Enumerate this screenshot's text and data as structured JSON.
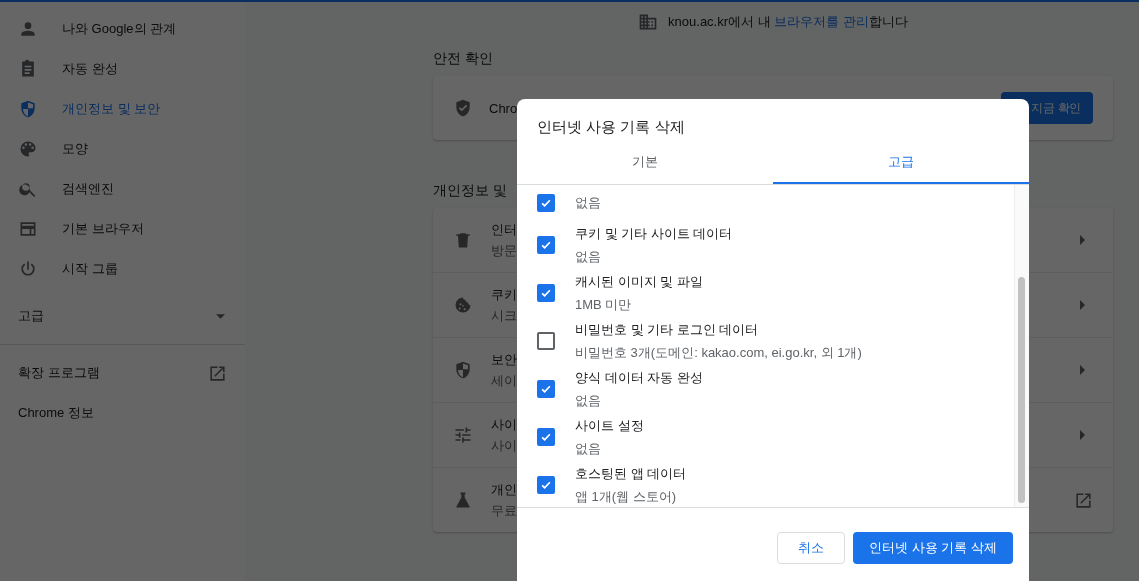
{
  "sidebar": {
    "items": [
      {
        "label": "나와 Google의 관계",
        "selected": false
      },
      {
        "label": "자동 완성",
        "selected": false
      },
      {
        "label": "개인정보 및 보안",
        "selected": true
      },
      {
        "label": "모양",
        "selected": false
      },
      {
        "label": "검색엔진",
        "selected": false
      },
      {
        "label": "기본 브라우저",
        "selected": false
      },
      {
        "label": "시작 그룹",
        "selected": false
      }
    ],
    "advanced": {
      "label": "고급",
      "expanded": false
    },
    "extensions": "확장 프로그램",
    "about": "Chrome 정보"
  },
  "managed_notice": {
    "before": "knou.ac.kr에서 내 ",
    "link": "브라우저를 관리",
    "after": "합니다"
  },
  "safety_check": {
    "heading": "안전 확인",
    "text": "Chro",
    "button": "지금 확인"
  },
  "privacy": {
    "heading": "개인정보 및",
    "rows": [
      {
        "title": "인터",
        "subtitle": "방문",
        "kind": "arrow"
      },
      {
        "title": "쿠키",
        "subtitle": "시크",
        "kind": "arrow"
      },
      {
        "title": "보안",
        "subtitle": "세이",
        "kind": "arrow"
      },
      {
        "title": "사이",
        "subtitle": "사이",
        "kind": "arrow"
      },
      {
        "title": "개인",
        "subtitle": "무료",
        "kind": "external"
      }
    ]
  },
  "dialog": {
    "title": "인터넷 사용 기록 삭제",
    "tabs": [
      {
        "label": "기본",
        "selected": false
      },
      {
        "label": "고급",
        "selected": true
      }
    ],
    "items": [
      {
        "detail": "없음",
        "checked": true
      },
      {
        "label": "쿠키 및 기타 사이트 데이터",
        "detail": "없음",
        "checked": true
      },
      {
        "label": "캐시된 이미지 및 파일",
        "detail": "1MB 미만",
        "checked": true
      },
      {
        "label": "비밀번호 및 기타 로그인 데이터",
        "detail": "비밀번호 3개(도메인: kakao.com, ei.go.kr, 외 1개)",
        "checked": false
      },
      {
        "label": "양식 데이터 자동 완성",
        "detail": "없음",
        "checked": true
      },
      {
        "label": "사이트 설정",
        "detail": "없음",
        "checked": true
      },
      {
        "label": "호스팅된 앱 데이터",
        "detail": "앱 1개(웹 스토어)",
        "checked": true
      }
    ],
    "cancel": "취소",
    "confirm": "인터넷 사용 기록 삭제"
  }
}
